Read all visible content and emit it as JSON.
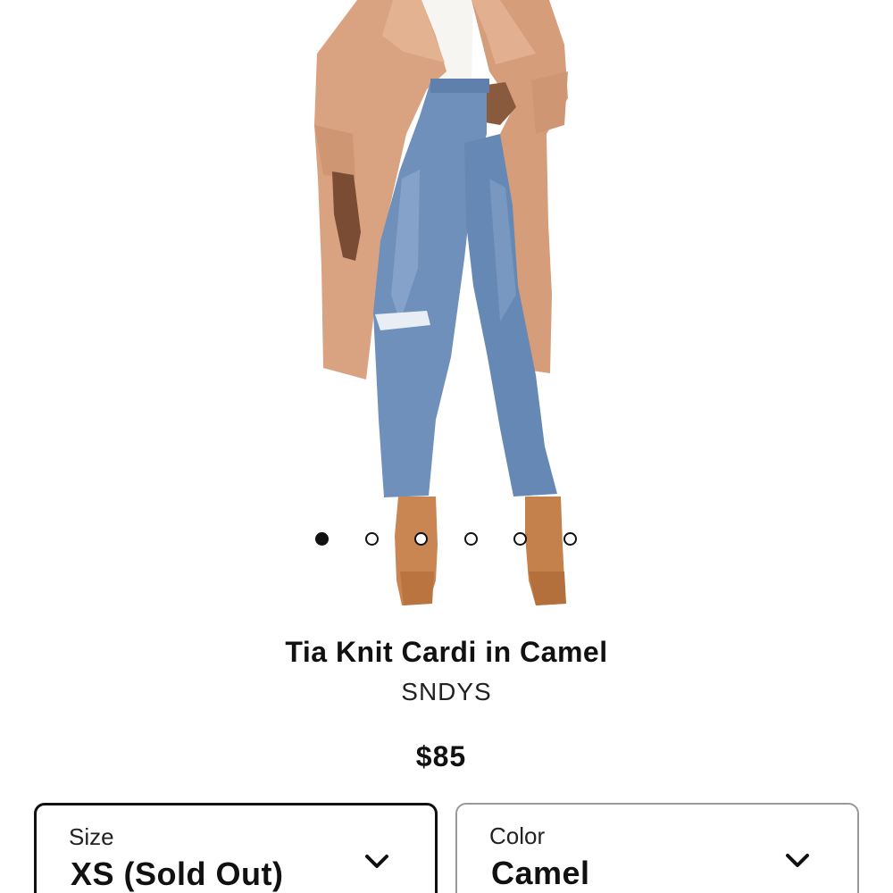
{
  "product": {
    "title": "Tia Knit Cardi in Camel",
    "brand": "SNDYS",
    "price": "$85"
  },
  "carousel": {
    "dot_count": 6,
    "active_index": 0
  },
  "selectors": {
    "size": {
      "label": "Size",
      "value": "XS (Sold Out)",
      "icon": "chevron-down-icon"
    },
    "color": {
      "label": "Color",
      "value": "Camel",
      "icon": "chevron-down-icon"
    }
  },
  "colors": {
    "coat": "#D9A381",
    "denim": "#6F90BB",
    "boots": "#C98652",
    "text": "#111111",
    "active_border": "#111111",
    "inactive_border": "#9A9A9A"
  }
}
